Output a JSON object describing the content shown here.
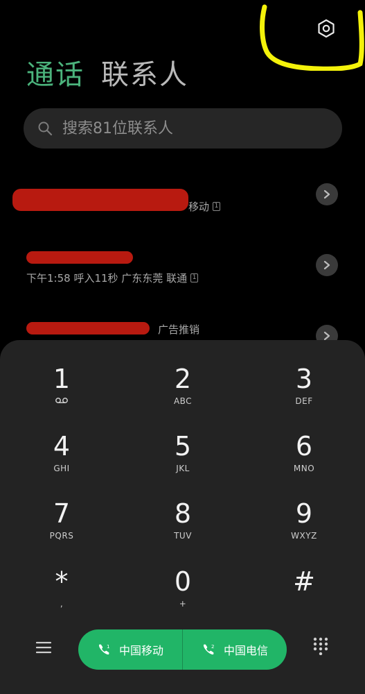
{
  "header": {
    "tabs": [
      {
        "label": "通话",
        "active": true
      },
      {
        "label": "联系人",
        "active": false
      }
    ],
    "settings_icon": "gear-hexagon-icon"
  },
  "search": {
    "placeholder": "搜索81位联系人"
  },
  "call_log": [
    {
      "detail": "移动",
      "sim": "1"
    },
    {
      "detail": "下午1:58  呼入11秒  广东东莞  联通",
      "sim": "1"
    },
    {
      "detail": "广告推销",
      "sim": ""
    }
  ],
  "dialpad": {
    "keys": [
      {
        "digit": "1",
        "letters": "",
        "icon": "voicemail-icon"
      },
      {
        "digit": "2",
        "letters": "ABC"
      },
      {
        "digit": "3",
        "letters": "DEF"
      },
      {
        "digit": "4",
        "letters": "GHI"
      },
      {
        "digit": "5",
        "letters": "JKL"
      },
      {
        "digit": "6",
        "letters": "MNO"
      },
      {
        "digit": "7",
        "letters": "PQRS"
      },
      {
        "digit": "8",
        "letters": "TUV"
      },
      {
        "digit": "9",
        "letters": "WXYZ"
      },
      {
        "digit": "*",
        "letters": ","
      },
      {
        "digit": "0",
        "letters": "+"
      },
      {
        "digit": "#",
        "letters": ""
      }
    ],
    "call_buttons": [
      {
        "label": "中国移动",
        "sim": "1"
      },
      {
        "label": "中国电信",
        "sim": "2"
      }
    ]
  },
  "colors": {
    "accent": "#4bb37c",
    "call_green": "#21b567",
    "redaction": "#b81a10",
    "highlight": "#f4f20a"
  }
}
